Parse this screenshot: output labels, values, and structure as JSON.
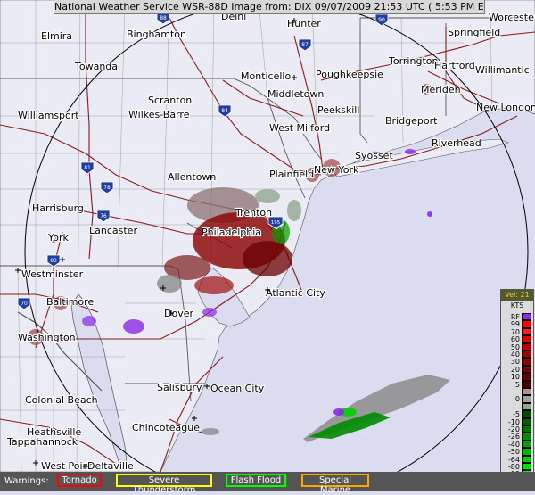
{
  "header": {
    "title": "National Weather Service WSR-88D Image from: DIX 09/07/2009 21:53 UTC ( 5:53 PM EDT)"
  },
  "map": {
    "cities": [
      {
        "id": "elmira",
        "label": "Elmira"
      },
      {
        "id": "binghamton",
        "label": "Binghamton"
      },
      {
        "id": "delhi",
        "label": "Delhi"
      },
      {
        "id": "hunter",
        "label": "Hunter"
      },
      {
        "id": "springfield",
        "label": "Springfield"
      },
      {
        "id": "worcester",
        "label": "Worcester"
      },
      {
        "id": "towanda",
        "label": "Towanda"
      },
      {
        "id": "monticello",
        "label": "Monticello"
      },
      {
        "id": "poughkeepsie",
        "label": "Poughkeepsie"
      },
      {
        "id": "torrington",
        "label": "Torrington"
      },
      {
        "id": "hartford",
        "label": "Hartford"
      },
      {
        "id": "willimantic",
        "label": "Willimantic"
      },
      {
        "id": "meriden",
        "label": "Meriden"
      },
      {
        "id": "new-london",
        "label": "New London"
      },
      {
        "id": "scranton",
        "label": "Scranton"
      },
      {
        "id": "middletown",
        "label": "Middletown"
      },
      {
        "id": "williamsport",
        "label": "Williamsport"
      },
      {
        "id": "wilkes-barre",
        "label": "Wilkes-Barre"
      },
      {
        "id": "peekskill",
        "label": "Peekskill"
      },
      {
        "id": "bridgeport",
        "label": "Bridgeport"
      },
      {
        "id": "west-milford",
        "label": "West Milford"
      },
      {
        "id": "riverhead",
        "label": "Riverhead"
      },
      {
        "id": "syosset",
        "label": "Syosset"
      },
      {
        "id": "allentown",
        "label": "Allentown"
      },
      {
        "id": "plainfield",
        "label": "Plainfield"
      },
      {
        "id": "new-york",
        "label": "New York"
      },
      {
        "id": "harrisburg",
        "label": "Harrisburg"
      },
      {
        "id": "trenton",
        "label": "Trenton"
      },
      {
        "id": "york",
        "label": "York"
      },
      {
        "id": "lancaster",
        "label": "Lancaster"
      },
      {
        "id": "philadelphia",
        "label": "Philadelphia"
      },
      {
        "id": "westminster",
        "label": "Westminster"
      },
      {
        "id": "atlantic-city",
        "label": "Atlantic City"
      },
      {
        "id": "baltimore",
        "label": "Baltimore"
      },
      {
        "id": "dover",
        "label": "Dover"
      },
      {
        "id": "washington",
        "label": "Washington"
      },
      {
        "id": "salisbury",
        "label": "Salisbury"
      },
      {
        "id": "ocean-city",
        "label": "Ocean City"
      },
      {
        "id": "colonial-beach",
        "label": "Colonial Beach"
      },
      {
        "id": "chincoteague",
        "label": "Chincoteague"
      },
      {
        "id": "heathsville",
        "label": "Heathsville"
      },
      {
        "id": "tappahannock",
        "label": "Tappahannock"
      },
      {
        "id": "west-point",
        "label": "West Point"
      },
      {
        "id": "deltaville",
        "label": "Deltaville"
      }
    ],
    "interstates": [
      "88",
      "90",
      "87",
      "84",
      "81",
      "78",
      "76",
      "83",
      "70",
      "95",
      "195"
    ]
  },
  "legend": {
    "title": "Vel: 21",
    "units": "KTS",
    "levels": [
      {
        "label": "RF",
        "color": "#8a2be2"
      },
      {
        "label": "99",
        "color": "#ff0000"
      },
      {
        "label": "70",
        "color": "#ff1a1a"
      },
      {
        "label": "60",
        "color": "#e00000"
      },
      {
        "label": "50",
        "color": "#c00000"
      },
      {
        "label": "40",
        "color": "#a00000"
      },
      {
        "label": "30",
        "color": "#8a0000"
      },
      {
        "label": "20",
        "color": "#760000"
      },
      {
        "label": "10",
        "color": "#600000"
      },
      {
        "label": "5",
        "color": "#500000"
      },
      {
        "label": "",
        "color": "#b49090"
      },
      {
        "label": "0",
        "color": "#a0a0a0"
      },
      {
        "label": "",
        "color": "#90a890"
      },
      {
        "label": "-5",
        "color": "#004c00"
      },
      {
        "label": "-10",
        "color": "#006000"
      },
      {
        "label": "-20",
        "color": "#007000"
      },
      {
        "label": "-26",
        "color": "#008a00"
      },
      {
        "label": "-40",
        "color": "#00a000"
      },
      {
        "label": "-50",
        "color": "#00b800"
      },
      {
        "label": "-64",
        "color": "#00d000"
      },
      {
        "label": "-80",
        "color": "#00e000"
      },
      {
        "label": "-99",
        "color": "#00ff00"
      },
      {
        "label": "ND",
        "color": "#6e6e6e"
      }
    ]
  },
  "warnings": {
    "label": "Warnings:",
    "items": [
      {
        "id": "tornado",
        "label": "Tornado",
        "color": "#ff0000"
      },
      {
        "id": "severe-thunderstorm",
        "label": "Severe Thunderstorm",
        "color": "#ffff00"
      },
      {
        "id": "flash-flood",
        "label": "Flash Flood",
        "color": "#00ff00"
      },
      {
        "id": "special-marine",
        "label": "Special Marine",
        "color": "#ffa500"
      }
    ]
  }
}
